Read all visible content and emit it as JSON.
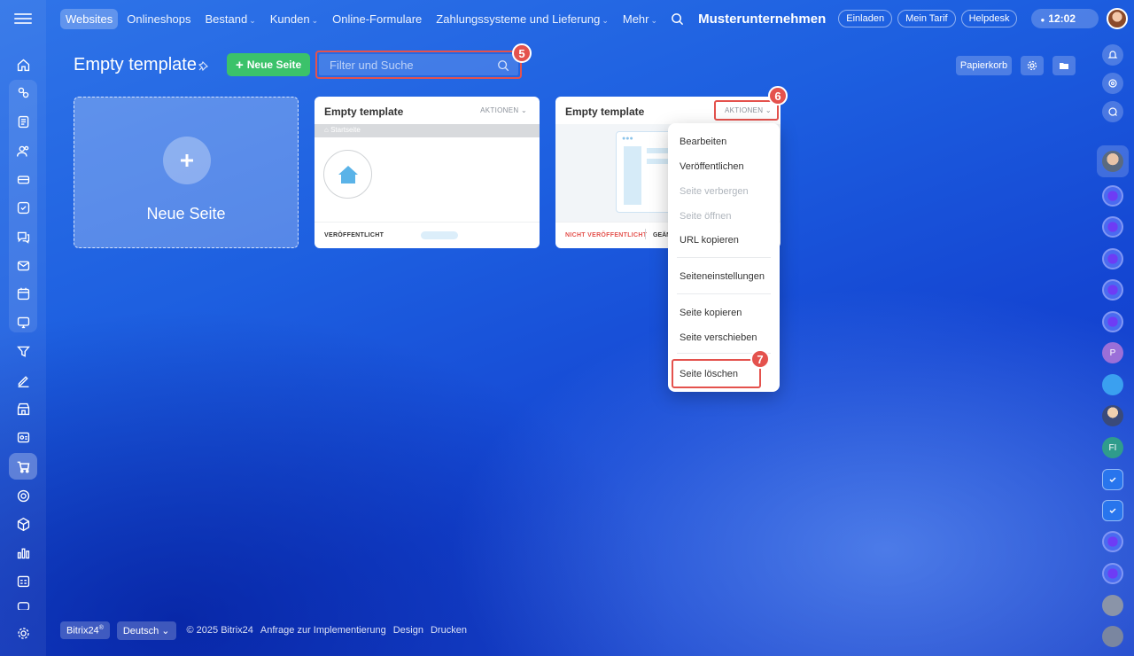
{
  "top_nav": {
    "items": [
      {
        "label": "Websites",
        "active": true,
        "has_dropdown": false
      },
      {
        "label": "Onlineshops",
        "active": false,
        "has_dropdown": false
      },
      {
        "label": "Bestand",
        "active": false,
        "has_dropdown": true
      },
      {
        "label": "Kunden",
        "active": false,
        "has_dropdown": true
      },
      {
        "label": "Online-Formulare",
        "active": false,
        "has_dropdown": false
      },
      {
        "label": "Zahlungssysteme und Lieferung",
        "active": false,
        "has_dropdown": true
      },
      {
        "label": "Mehr",
        "active": false,
        "has_dropdown": true
      }
    ],
    "company": "Musterunternehmen",
    "invite": "Einladen",
    "tariff": "Mein Tarif",
    "helpdesk": "Helpdesk",
    "time": "12:02"
  },
  "page": {
    "title": "Empty template",
    "new_button": "Neue Seite",
    "search_placeholder": "Filter und Suche",
    "trash": "Papierkorb"
  },
  "new_card": {
    "label": "Neue Seite"
  },
  "cards": [
    {
      "title": "Empty template",
      "actions": "AKTIONEN",
      "preview_header": "Startseite",
      "status": "VERÖFFENTLICHT"
    },
    {
      "title": "Empty template",
      "actions": "AKTIONEN",
      "status": "NICHT VERÖFFENTLICHT",
      "status_extra": "GEÄN"
    }
  ],
  "dropdown": {
    "items": [
      {
        "label": "Bearbeiten",
        "disabled": false
      },
      {
        "label": "Veröffentlichen",
        "disabled": false
      },
      {
        "label": "Seite verbergen",
        "disabled": true
      },
      {
        "label": "Seite öffnen",
        "disabled": true
      },
      {
        "label": "URL kopieren",
        "disabled": false
      },
      {
        "label": "Seiteneinstellungen",
        "disabled": false
      },
      {
        "label": "Seite kopieren",
        "disabled": false
      },
      {
        "label": "Seite verschieben",
        "disabled": false
      },
      {
        "label": "Seite löschen",
        "disabled": false
      }
    ]
  },
  "badges": {
    "b5": "5",
    "b6": "6",
    "b7": "7"
  },
  "right_bar": {
    "p_label": "P",
    "fi_label": "FI"
  },
  "footer": {
    "brand": "Bitrix24",
    "language": "Deutsch",
    "copyright": "© 2025 Bitrix24",
    "links": [
      "Anfrage zur Implementierung",
      "Design",
      "Drucken"
    ]
  },
  "colors": {
    "accent_green": "#3bc26a",
    "highlight_red": "#e4524d",
    "background_blue": "#1d5fe0"
  }
}
